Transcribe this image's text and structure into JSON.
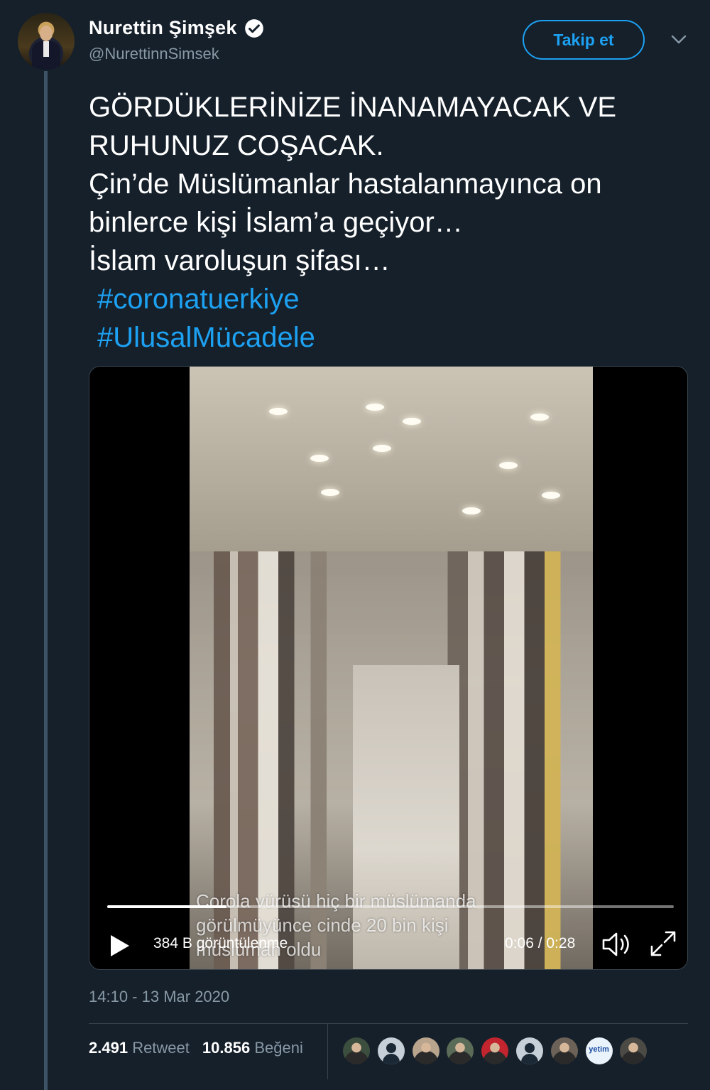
{
  "author": {
    "display_name": "Nurettin Şimşek",
    "handle": "@NurettinnSimsek",
    "verified": true
  },
  "follow_button_label": "Takip et",
  "tweet": {
    "lines": [
      "GÖRDÜKLERİNİZE İNANAMAYACAK VE",
      "RUHUNUZ COŞACAK.",
      "Çin’de Müslümanlar hastalanmayınca on",
      "binlerce kişi İslam’a geçiyor…",
      "İslam varoluşun şifası…"
    ],
    "hashtags": [
      "#coronatuerkiye",
      "#UlusalMücadele"
    ]
  },
  "video": {
    "subtitle": "Corola vürüsü hiç bir müslümanda\ngörülmüyünce cinde 20 bin kişi\nmüslüman oldu",
    "views": "384 B görüntülenme",
    "time": "0:06 / 0:28",
    "progress": 0.21
  },
  "timestamp": "14:10 - 13 Mar 2020",
  "stats": {
    "retweet_count": "2.491",
    "retweet_label": "Retweet",
    "like_count": "10.856",
    "like_label": "Beğeni"
  },
  "likers": [
    {
      "icon": "user-photo",
      "color": "#3c4f3e"
    },
    {
      "icon": "default-avatar",
      "color": "#c7d0d8"
    },
    {
      "icon": "user-photo",
      "color": "#b9a58e"
    },
    {
      "icon": "user-photo",
      "color": "#5a6b58"
    },
    {
      "icon": "user-photo",
      "color": "#c2252e"
    },
    {
      "icon": "default-avatar",
      "color": "#c7d0d8"
    },
    {
      "icon": "user-photo",
      "color": "#6d6258"
    },
    {
      "icon": "yetim-logo",
      "color": "#eaf3fb",
      "text": "yetim"
    },
    {
      "icon": "user-photo",
      "color": "#4c4a44"
    }
  ],
  "colors": {
    "background": "#15202b",
    "accent": "#1da1f2",
    "secondary_text": "#8899a6",
    "border": "#38444d"
  }
}
